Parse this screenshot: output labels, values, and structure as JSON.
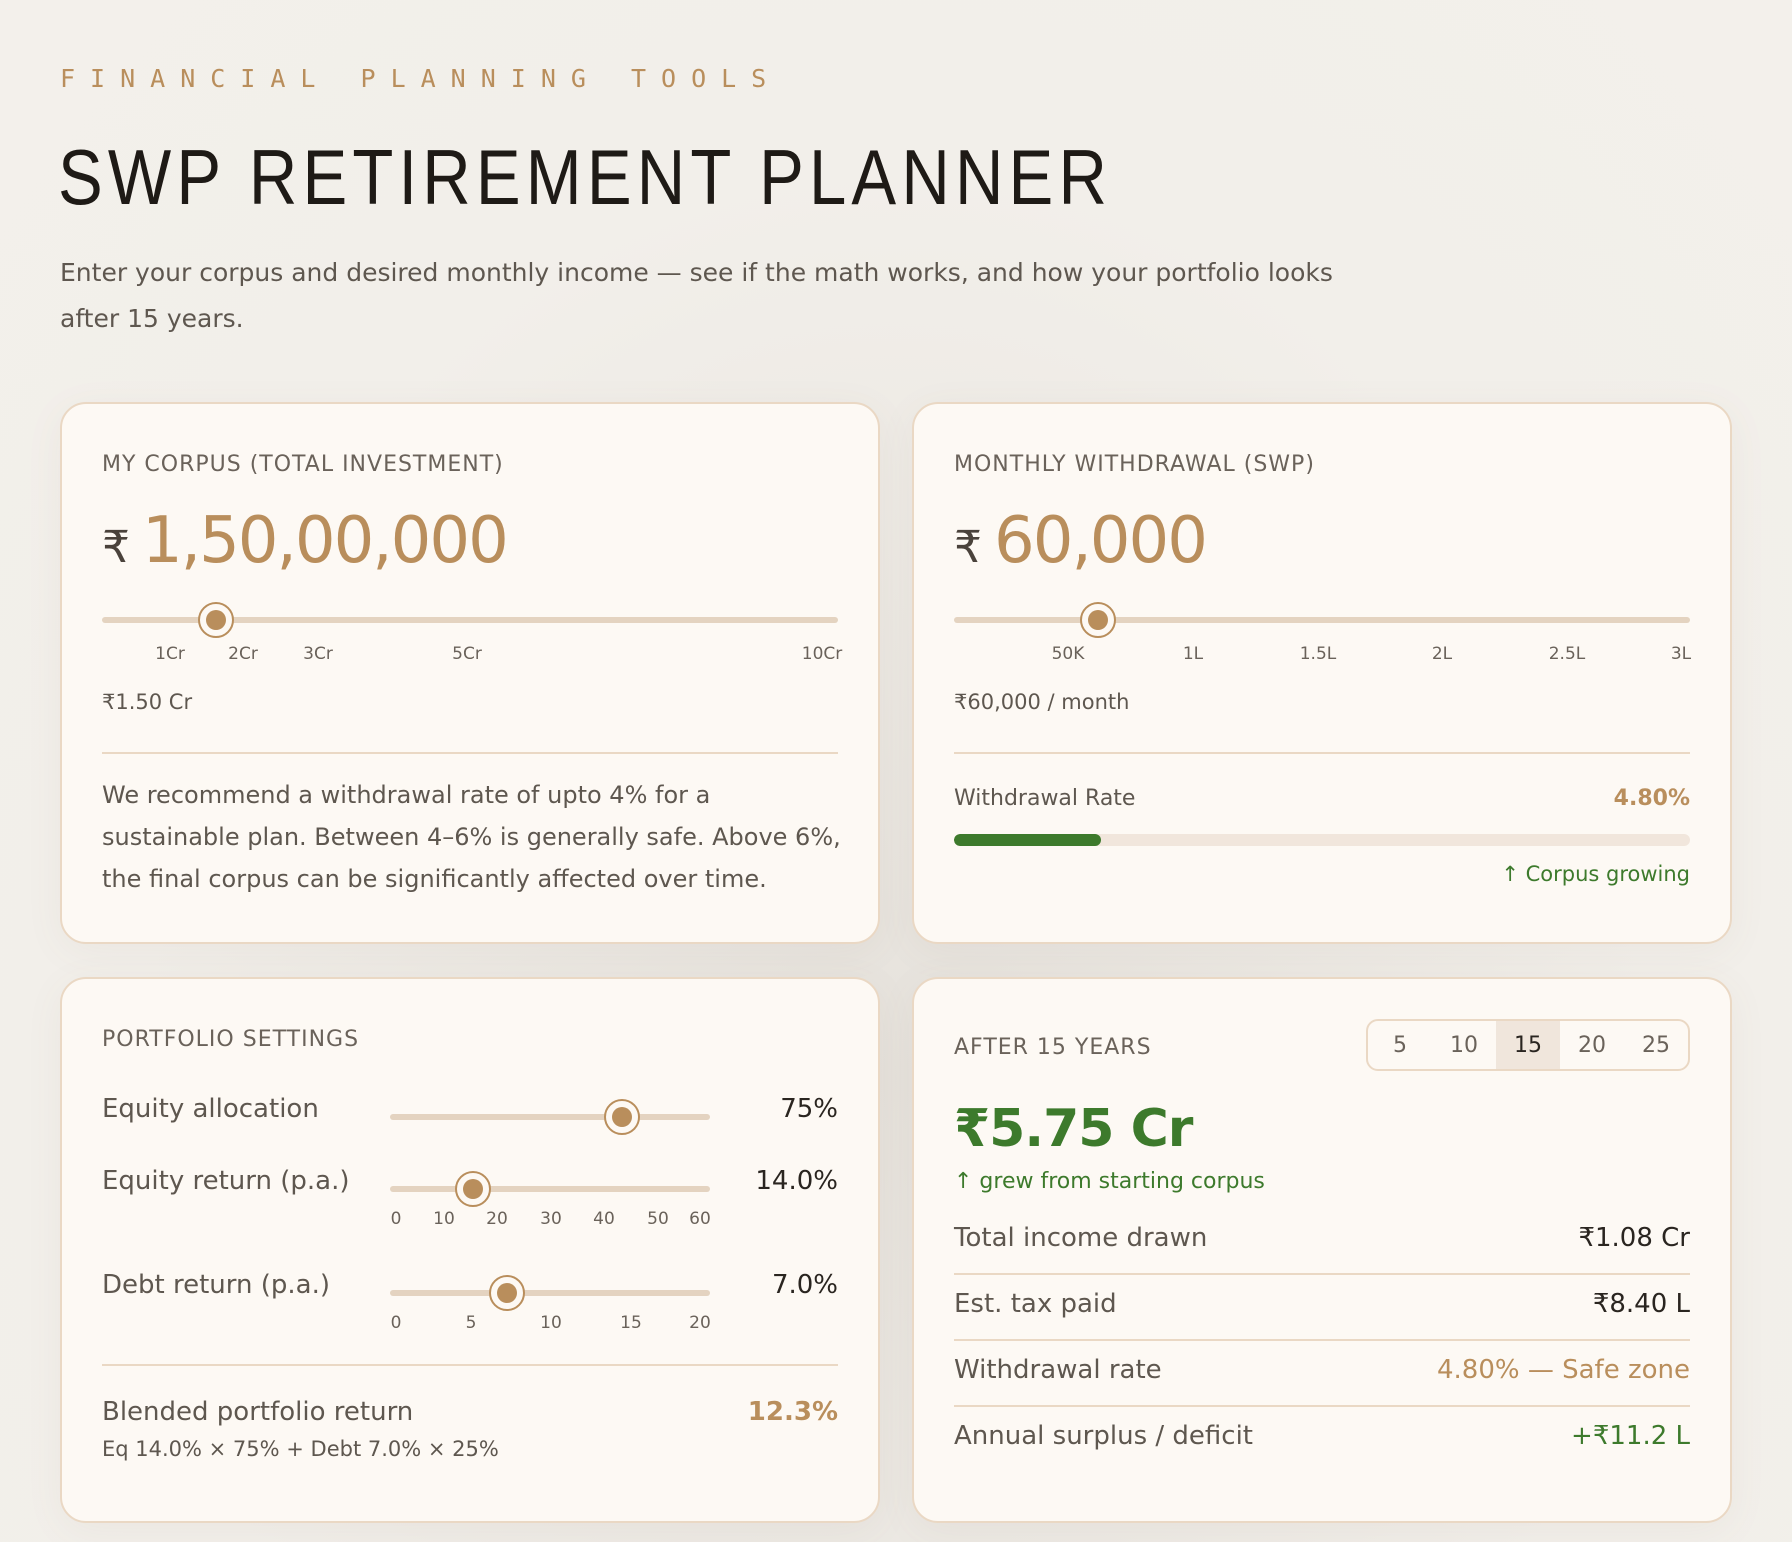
{
  "header": {
    "eyebrow": "FINANCIAL PLANNING TOOLS",
    "title": "SWP RETIREMENT PLANNER",
    "subtitle": "Enter your corpus and desired monthly income — see if the math works, and how your portfolio looks after 15 years."
  },
  "corpus": {
    "label": "MY CORPUS (TOTAL INVESTMENT)",
    "currency_symbol": "₹",
    "amount": "1,50,00,000",
    "slider_value": "₹1.50 Cr",
    "ticks": [
      "1Cr",
      "2Cr",
      "3Cr",
      "5Cr",
      "10Cr"
    ],
    "caption": "₹1.50 Cr",
    "recommendation": "We recommend a withdrawal rate of upto 4% for a sustainable plan.  Between 4–6% is generally safe. Above 6%, the final corpus can be significantly affected over time."
  },
  "swp": {
    "label": "MONTHLY WITHDRAWAL (SWP)",
    "currency_symbol": "₹",
    "amount": "60,000",
    "ticks": [
      "50K",
      "1L",
      "1.5L",
      "2L",
      "2.5L",
      "3L"
    ],
    "caption": "₹60,000 / month",
    "rate_label": "Withdrawal  Rate",
    "rate_value": "4.80%",
    "rate_fill_fraction": 0.2,
    "status": "↑ Corpus growing"
  },
  "portfolio": {
    "label": "PORTFOLIO SETTINGS",
    "equity_allocation": {
      "label": "Equity allocation",
      "value": "75%",
      "level": 0.75
    },
    "equity_return": {
      "label": "Equity return (p.a.)",
      "value": "14.0%",
      "ticks": [
        "0",
        "10",
        "20",
        "30",
        "40",
        "50",
        "60"
      ],
      "level": 0.233
    },
    "debt_return": {
      "label": "Debt return (p.a.)",
      "value": "7.0%",
      "ticks": [
        "0",
        "5",
        "10",
        "15",
        "20"
      ],
      "level": 0.35
    },
    "blended_label": "Blended portfolio return",
    "blended_value": "12.3%",
    "blended_formula": "Eq 14.0% × 75% +  Debt 7.0% × 25%"
  },
  "after": {
    "label": "AFTER 15 YEARS",
    "year_options": [
      "5",
      "10",
      "15",
      "20",
      "25"
    ],
    "selected_year": "15",
    "final_corpus": "₹5.75 Cr",
    "grew_note": "↑ grew from starting corpus",
    "rows": [
      {
        "label": "Total income drawn",
        "value": "₹1.08 Cr"
      },
      {
        "label": "Est. tax paid",
        "value": "₹8.40  L"
      },
      {
        "label": "Withdrawal rate",
        "value": "4.80% — Safe zone"
      },
      {
        "label": "Annual surplus / deficit",
        "value": "+₹11.2  L"
      }
    ]
  },
  "colors": {
    "accent": "#b98e5c",
    "positive": "#3d7a2c",
    "card_bg": "#fdf9f4",
    "card_border": "#ead8c4"
  }
}
